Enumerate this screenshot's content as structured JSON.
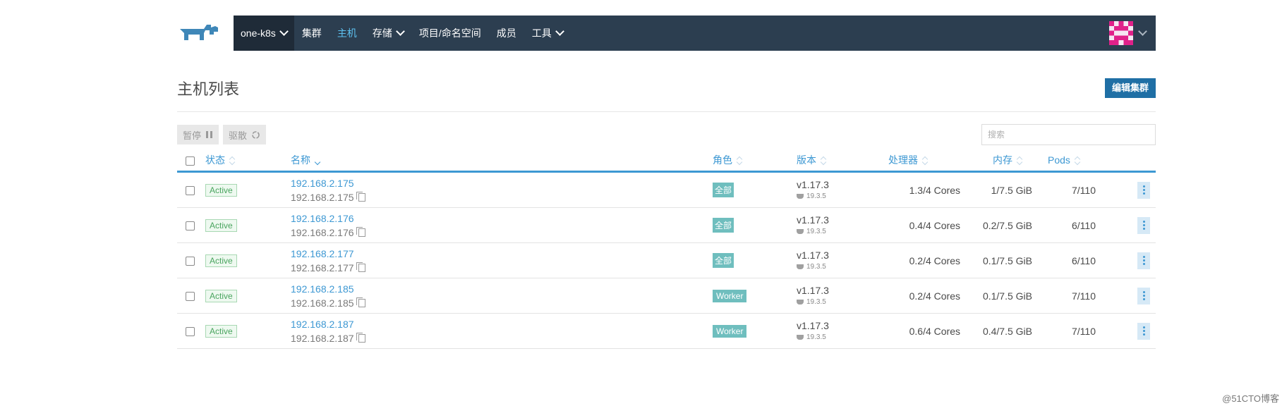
{
  "nav": {
    "cluster": "one-k8s",
    "items": [
      "集群",
      "主机",
      "存储",
      "项目/命名空间",
      "成员",
      "工具"
    ]
  },
  "page": {
    "title": "主机列表",
    "edit_button": "编辑集群"
  },
  "toolbar": {
    "pause": "暂停",
    "drain": "驱散",
    "search_placeholder": "搜索"
  },
  "table": {
    "headers": {
      "state": "状态",
      "name": "名称",
      "role": "角色",
      "version": "版本",
      "cpu": "处理器",
      "memory": "内存",
      "pods": "Pods"
    },
    "rows": [
      {
        "state": "Active",
        "name": "192.168.2.175",
        "ip": "192.168.2.175",
        "role": "全部",
        "version": "v1.17.3",
        "docker": "19.3.5",
        "cpu": "1.3/4 Cores",
        "memory": "1/7.5 GiB",
        "pods": "7/110"
      },
      {
        "state": "Active",
        "name": "192.168.2.176",
        "ip": "192.168.2.176",
        "role": "全部",
        "version": "v1.17.3",
        "docker": "19.3.5",
        "cpu": "0.4/4 Cores",
        "memory": "0.2/7.5 GiB",
        "pods": "6/110"
      },
      {
        "state": "Active",
        "name": "192.168.2.177",
        "ip": "192.168.2.177",
        "role": "全部",
        "version": "v1.17.3",
        "docker": "19.3.5",
        "cpu": "0.2/4 Cores",
        "memory": "0.1/7.5 GiB",
        "pods": "6/110"
      },
      {
        "state": "Active",
        "name": "192.168.2.185",
        "ip": "192.168.2.185",
        "role": "Worker",
        "version": "v1.17.3",
        "docker": "19.3.5",
        "cpu": "0.2/4 Cores",
        "memory": "0.1/7.5 GiB",
        "pods": "7/110"
      },
      {
        "state": "Active",
        "name": "192.168.2.187",
        "ip": "192.168.2.187",
        "role": "Worker",
        "version": "v1.17.3",
        "docker": "19.3.5",
        "cpu": "0.6/4 Cores",
        "memory": "0.4/7.5 GiB",
        "pods": "7/110"
      }
    ]
  },
  "watermark": "@51CTO博客",
  "colors": {
    "navbar": "#2c3e50",
    "accent": "#3d98d3",
    "primary_button": "#1f6fa5",
    "role_badge": "#6fbebe",
    "active_badge": "#4aa55f"
  },
  "icons": {
    "logo": "rancher-cow-logo",
    "pause": "pause-icon",
    "drain": "refresh-icon",
    "copy": "copy-icon",
    "docker": "docker-icon",
    "more": "more-vertical-icon"
  }
}
